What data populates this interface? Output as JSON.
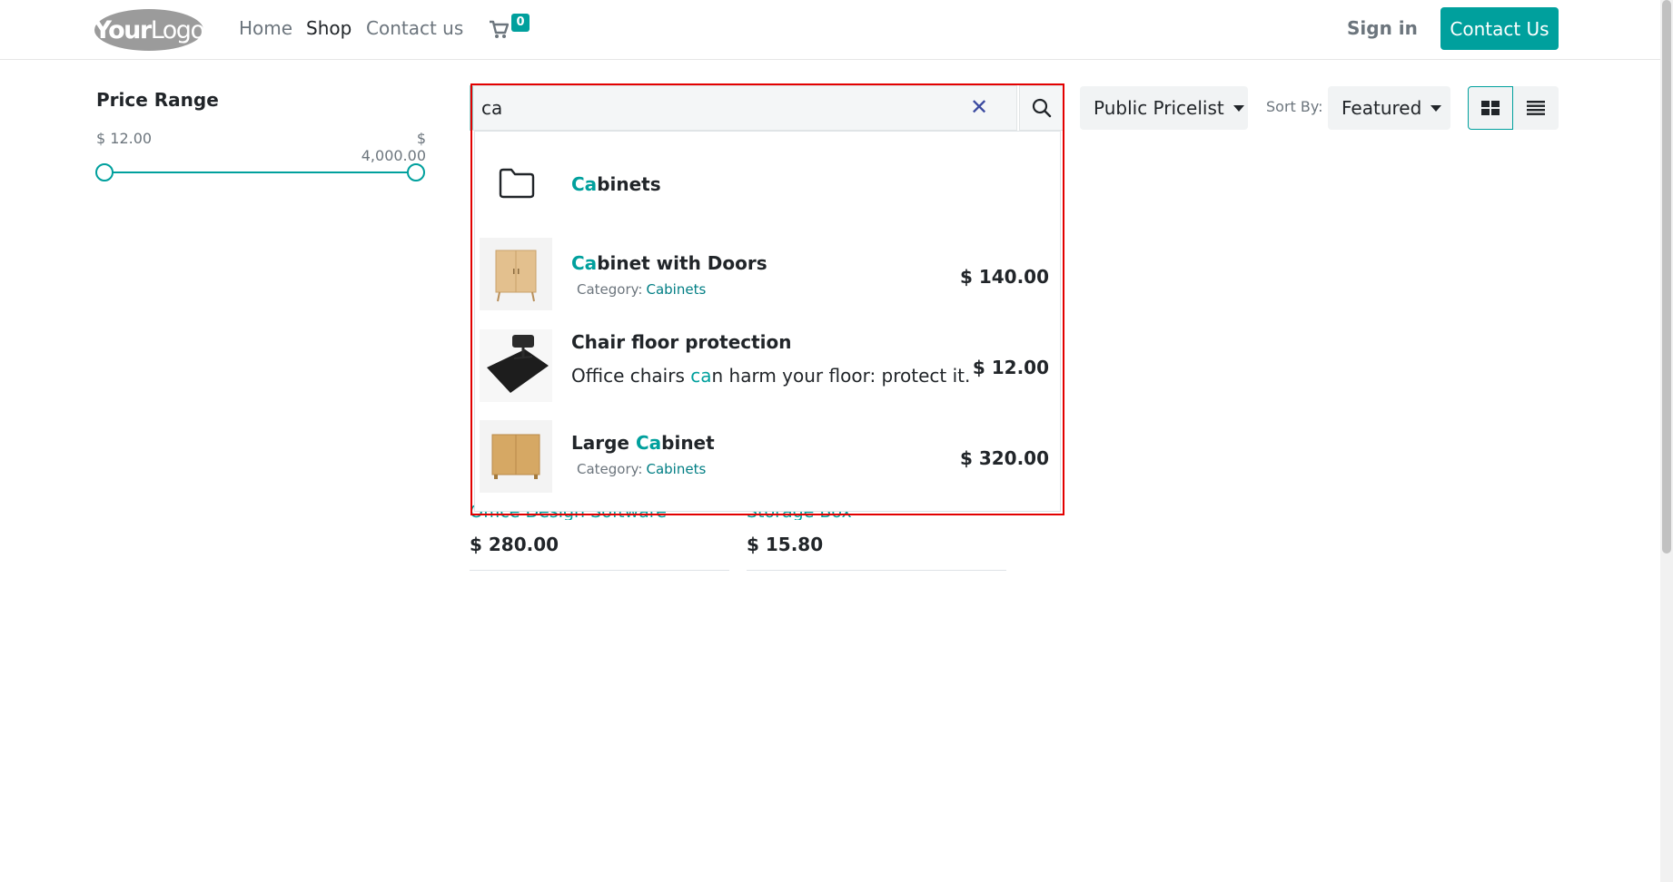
{
  "header": {
    "logo": {
      "bold": "Your",
      "light": "Logo"
    },
    "nav": {
      "home": "Home",
      "shop": "Shop",
      "contact": "Contact us"
    },
    "cart_count": "0",
    "sign_in": "Sign in",
    "contact_button": "Contact Us"
  },
  "sidebar": {
    "price_range_title": "Price Range",
    "price_min": "$ 12.00",
    "price_max": "$ 4,000.00"
  },
  "search": {
    "value": "ca",
    "clear_symbol": "✕"
  },
  "toolbar": {
    "pricelist": "Public Pricelist",
    "sort_label": "Sort By:",
    "sort_value": "Featured"
  },
  "dropdown": {
    "category": {
      "hl": "Ca",
      "rest": "binets"
    },
    "results": [
      {
        "name_hl": "Ca",
        "name_rest": "binet with Doors",
        "category_label": "Category:",
        "category": "Cabinets",
        "price": "$ 140.00"
      },
      {
        "name": "Chair floor protection",
        "desc_pre": "Office chairs ",
        "desc_hl": "ca",
        "desc_post": "n harm your floor: protect it.",
        "price": "$ 12.00"
      },
      {
        "name_pre": "Large ",
        "name_hl": "Ca",
        "name_rest": "binet",
        "category_label": "Category:",
        "category": "Cabinets",
        "price": "$ 320.00"
      }
    ]
  },
  "products": [
    {
      "partial_name": "Office Design Software",
      "price": "$ 280.00"
    },
    {
      "partial_name": "Storage Box",
      "price": "$ 15.80"
    }
  ],
  "colors": {
    "accent": "#00a09d",
    "highlight_frame": "#e30000"
  },
  "icons": [
    "cart-icon",
    "search-icon",
    "folder-icon",
    "grid-icon",
    "list-icon",
    "close-icon"
  ]
}
